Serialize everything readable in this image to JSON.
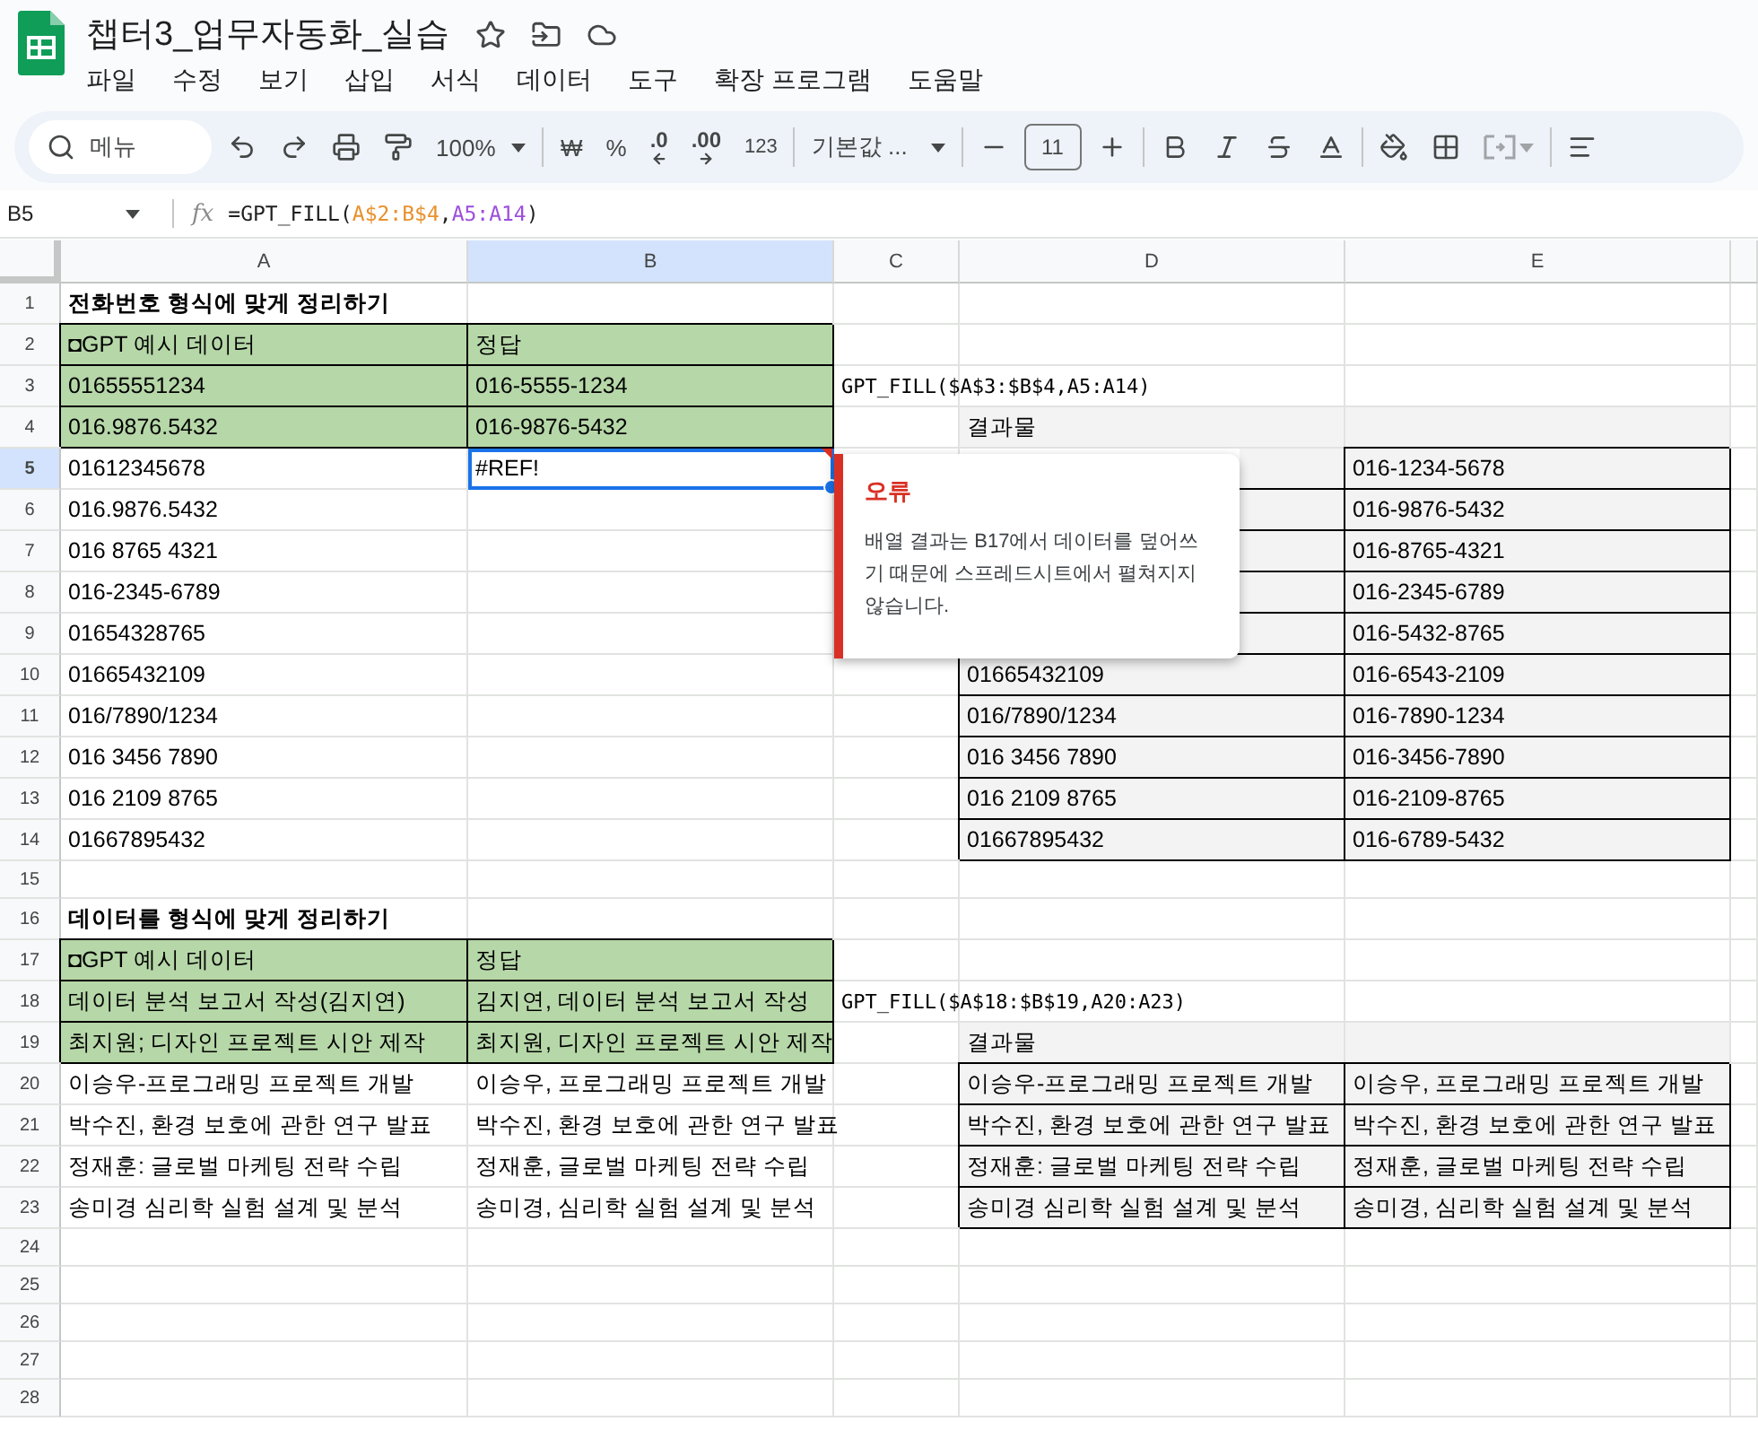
{
  "document": {
    "title": "챕터3_업무자동화_실습",
    "menu": [
      "파일",
      "수정",
      "보기",
      "삽입",
      "서식",
      "데이터",
      "도구",
      "확장 프로그램",
      "도움말"
    ]
  },
  "toolbar": {
    "search_label": "메뉴",
    "zoom": "100%",
    "currency": "₩",
    "percent": "%",
    "decimal_decrease": ".0",
    "decimal_increase": ".00",
    "number_format": "123",
    "font": "기본값 ...",
    "font_size": "11"
  },
  "formula_bar": {
    "cell_ref": "B5",
    "fx_label": "fx",
    "formula": [
      {
        "text": "=GPT_FILL(",
        "color": "#1f1f1f"
      },
      {
        "text": "A$2:B$4",
        "color": "#e8912d"
      },
      {
        "text": ",",
        "color": "#1f1f1f"
      },
      {
        "text": "A5:A14",
        "color": "#9d4edd"
      },
      {
        "text": ")",
        "color": "#1f1f1f"
      }
    ]
  },
  "columns": [
    {
      "label": "A",
      "selected": false
    },
    {
      "label": "B",
      "selected": true
    },
    {
      "label": "C",
      "selected": false
    },
    {
      "label": "D",
      "selected": false
    },
    {
      "label": "E",
      "selected": false
    }
  ],
  "rows": [
    {
      "number": "1",
      "selected": false,
      "cells": [
        {
          "kind": "title",
          "text": "전화번호 형식에 맞게 정리하기"
        }
      ]
    },
    {
      "number": "2",
      "selected": false,
      "cells": [
        {
          "kind": "sample",
          "text": "◘GPT 예시 데이터"
        },
        {
          "kind": "sample",
          "text": "정답"
        }
      ]
    },
    {
      "number": "3",
      "selected": false,
      "cells": [
        {
          "kind": "sample",
          "text": "01655551234"
        },
        {
          "kind": "sample",
          "text": "016-5555-1234"
        },
        {
          "kind": "formula",
          "text": "GPT_FILL($A$3:$B$4,A5:A14)"
        }
      ]
    },
    {
      "number": "4",
      "selected": false,
      "cells": [
        {
          "kind": "sample",
          "text": "016.9876.5432"
        },
        {
          "kind": "sample",
          "text": "016-9876-5432"
        },
        {
          "kind": "plain"
        },
        {
          "kind": "result_label",
          "text": "결과물"
        },
        {
          "kind": "result_label"
        }
      ]
    },
    {
      "number": "5",
      "selected": true,
      "cells": [
        {
          "kind": "plain",
          "text": "01612345678"
        },
        {
          "kind": "plain",
          "text": "#REF!"
        },
        {
          "kind": "plain"
        },
        {
          "kind": "result"
        },
        {
          "kind": "result",
          "text": "016-1234-5678"
        }
      ]
    },
    {
      "number": "6",
      "selected": false,
      "cells": [
        {
          "kind": "plain",
          "text": "016.9876.5432"
        },
        {
          "kind": "plain"
        },
        {
          "kind": "plain"
        },
        {
          "kind": "result"
        },
        {
          "kind": "result",
          "text": "016-9876-5432"
        }
      ]
    },
    {
      "number": "7",
      "selected": false,
      "cells": [
        {
          "kind": "plain",
          "text": "016 8765 4321"
        },
        {
          "kind": "plain"
        },
        {
          "kind": "plain"
        },
        {
          "kind": "result"
        },
        {
          "kind": "result",
          "text": "016-8765-4321"
        }
      ]
    },
    {
      "number": "8",
      "selected": false,
      "cells": [
        {
          "kind": "plain",
          "text": "016-2345-6789"
        },
        {
          "kind": "plain"
        },
        {
          "kind": "plain"
        },
        {
          "kind": "result"
        },
        {
          "kind": "result",
          "text": "016-2345-6789"
        }
      ]
    },
    {
      "number": "9",
      "selected": false,
      "cells": [
        {
          "kind": "plain",
          "text": "01654328765"
        },
        {
          "kind": "plain"
        },
        {
          "kind": "plain"
        },
        {
          "kind": "result"
        },
        {
          "kind": "result",
          "text": "016-5432-8765"
        }
      ]
    },
    {
      "number": "10",
      "selected": false,
      "cells": [
        {
          "kind": "plain",
          "text": "01665432109"
        },
        {
          "kind": "plain"
        },
        {
          "kind": "plain"
        },
        {
          "kind": "result",
          "text": "01665432109"
        },
        {
          "kind": "result",
          "text": "016-6543-2109"
        }
      ]
    },
    {
      "number": "11",
      "selected": false,
      "cells": [
        {
          "kind": "plain",
          "text": "016/7890/1234"
        },
        {
          "kind": "plain"
        },
        {
          "kind": "plain"
        },
        {
          "kind": "result",
          "text": "016/7890/1234"
        },
        {
          "kind": "result",
          "text": "016-7890-1234"
        }
      ]
    },
    {
      "number": "12",
      "selected": false,
      "cells": [
        {
          "kind": "plain",
          "text": "016 3456 7890"
        },
        {
          "kind": "plain"
        },
        {
          "kind": "plain"
        },
        {
          "kind": "result",
          "text": "016 3456 7890"
        },
        {
          "kind": "result",
          "text": "016-3456-7890"
        }
      ]
    },
    {
      "number": "13",
      "selected": false,
      "cells": [
        {
          "kind": "plain",
          "text": "016 2109 8765"
        },
        {
          "kind": "plain"
        },
        {
          "kind": "plain"
        },
        {
          "kind": "result",
          "text": "016 2109 8765"
        },
        {
          "kind": "result",
          "text": "016-2109-8765"
        }
      ]
    },
    {
      "number": "14",
      "selected": false,
      "cells": [
        {
          "kind": "plain",
          "text": "01667895432"
        },
        {
          "kind": "plain"
        },
        {
          "kind": "plain"
        },
        {
          "kind": "result",
          "text": "01667895432"
        },
        {
          "kind": "result",
          "text": "016-6789-5432"
        }
      ]
    },
    {
      "number": "15",
      "selected": false,
      "cells": []
    },
    {
      "number": "16",
      "selected": false,
      "cells": [
        {
          "kind": "title",
          "text": "데이터를 형식에 맞게 정리하기"
        }
      ]
    },
    {
      "number": "17",
      "selected": false,
      "cells": [
        {
          "kind": "sample",
          "text": "◘GPT 예시 데이터"
        },
        {
          "kind": "sample",
          "text": "정답"
        }
      ]
    },
    {
      "number": "18",
      "selected": false,
      "cells": [
        {
          "kind": "sample",
          "text": "데이터 분석 보고서 작성(김지연)"
        },
        {
          "kind": "sample",
          "text": "김지연, 데이터 분석 보고서 작성"
        },
        {
          "kind": "formula",
          "text": "GPT_FILL($A$18:$B$19,A20:A23)"
        }
      ]
    },
    {
      "number": "19",
      "selected": false,
      "cells": [
        {
          "kind": "sample",
          "text": "최지원; 디자인 프로젝트 시안 제작"
        },
        {
          "kind": "sample",
          "text": "최지원, 디자인 프로젝트 시안 제작"
        },
        {
          "kind": "plain"
        },
        {
          "kind": "result_label",
          "text": "결과물"
        },
        {
          "kind": "result_label"
        }
      ]
    },
    {
      "number": "20",
      "selected": false,
      "cells": [
        {
          "kind": "plain",
          "text": "이승우-프로그래밍 프로젝트 개발"
        },
        {
          "kind": "plain",
          "text": "이승우, 프로그래밍 프로젝트 개발"
        },
        {
          "kind": "plain"
        },
        {
          "kind": "result",
          "text": "이승우-프로그래밍 프로젝트 개발"
        },
        {
          "kind": "result",
          "text": "이승우, 프로그래밍 프로젝트 개발"
        }
      ]
    },
    {
      "number": "21",
      "selected": false,
      "cells": [
        {
          "kind": "plain",
          "text": "박수진, 환경 보호에 관한 연구 발표"
        },
        {
          "kind": "plain",
          "text": "박수진, 환경 보호에 관한 연구 발표"
        },
        {
          "kind": "plain"
        },
        {
          "kind": "result",
          "text": "박수진, 환경 보호에 관한 연구 발표"
        },
        {
          "kind": "result",
          "text": "박수진, 환경 보호에 관한 연구 발표"
        }
      ]
    },
    {
      "number": "22",
      "selected": false,
      "cells": [
        {
          "kind": "plain",
          "text": "정재훈: 글로벌 마케팅 전략 수립"
        },
        {
          "kind": "plain",
          "text": "정재훈, 글로벌 마케팅 전략 수립"
        },
        {
          "kind": "plain"
        },
        {
          "kind": "result",
          "text": "정재훈: 글로벌 마케팅 전략 수립"
        },
        {
          "kind": "result",
          "text": "정재훈, 글로벌 마케팅 전략 수립"
        }
      ]
    },
    {
      "number": "23",
      "selected": false,
      "cells": [
        {
          "kind": "plain",
          "text": "송미경 심리학 실험 설계 및 분석"
        },
        {
          "kind": "plain",
          "text": "송미경, 심리학 실험 설계 및 분석"
        },
        {
          "kind": "plain"
        },
        {
          "kind": "result",
          "text": "송미경 심리학 실험 설계 및 분석"
        },
        {
          "kind": "result",
          "text": "송미경, 심리학 실험 설계 및 분석"
        }
      ]
    },
    {
      "number": "24",
      "selected": false,
      "cells": []
    },
    {
      "number": "25",
      "selected": false,
      "cells": []
    },
    {
      "number": "26",
      "selected": false,
      "cells": []
    },
    {
      "number": "27",
      "selected": false,
      "cells": []
    },
    {
      "number": "28",
      "selected": false,
      "cells": []
    }
  ],
  "error_popup": {
    "title": "오류",
    "message": "배열 결과는 B17에서 데이터를 덮어쓰기 때문에 스프레드시트에서 펼쳐지지 않습니다."
  }
}
